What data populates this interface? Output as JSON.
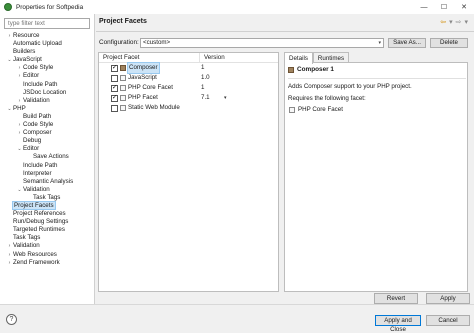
{
  "window": {
    "title": "Properties for Softpedia",
    "minimize": "—",
    "maximize": "☐",
    "close": "✕"
  },
  "sidebar": {
    "filter_placeholder": "type filter text",
    "items": [
      {
        "label": "Resource",
        "arrow": "›",
        "indent": 0
      },
      {
        "label": "Automatic Upload",
        "arrow": "",
        "indent": 0
      },
      {
        "label": "Builders",
        "arrow": "",
        "indent": 0
      },
      {
        "label": "JavaScript",
        "arrow": "⌄",
        "indent": 0
      },
      {
        "label": "Code Style",
        "arrow": "›",
        "indent": 1
      },
      {
        "label": "Editor",
        "arrow": "›",
        "indent": 1
      },
      {
        "label": "Include Path",
        "arrow": "",
        "indent": 1
      },
      {
        "label": "JSDoc Location",
        "arrow": "",
        "indent": 1
      },
      {
        "label": "Validation",
        "arrow": "›",
        "indent": 1
      },
      {
        "label": "PHP",
        "arrow": "⌄",
        "indent": 0
      },
      {
        "label": "Build Path",
        "arrow": "",
        "indent": 1
      },
      {
        "label": "Code Style",
        "arrow": "›",
        "indent": 1
      },
      {
        "label": "Composer",
        "arrow": "›",
        "indent": 1
      },
      {
        "label": "Debug",
        "arrow": "",
        "indent": 1
      },
      {
        "label": "Editor",
        "arrow": "⌄",
        "indent": 1
      },
      {
        "label": "Save Actions",
        "arrow": "",
        "indent": 2
      },
      {
        "label": "Include Path",
        "arrow": "",
        "indent": 1
      },
      {
        "label": "Interpreter",
        "arrow": "",
        "indent": 1
      },
      {
        "label": "Semantic Analysis",
        "arrow": "",
        "indent": 1
      },
      {
        "label": "Validation",
        "arrow": "⌄",
        "indent": 1
      },
      {
        "label": "Task Tags",
        "arrow": "",
        "indent": 2
      },
      {
        "label": "Project Facets",
        "arrow": "",
        "indent": 0,
        "selected": true
      },
      {
        "label": "Project References",
        "arrow": "",
        "indent": 0
      },
      {
        "label": "Run/Debug Settings",
        "arrow": "",
        "indent": 0
      },
      {
        "label": "Targeted Runtimes",
        "arrow": "",
        "indent": 0
      },
      {
        "label": "Task Tags",
        "arrow": "",
        "indent": 0
      },
      {
        "label": "Validation",
        "arrow": "›",
        "indent": 0
      },
      {
        "label": "Web Resources",
        "arrow": "›",
        "indent": 0
      },
      {
        "label": "Zend Framework",
        "arrow": "›",
        "indent": 0
      }
    ]
  },
  "main": {
    "page_title": "Project Facets",
    "nav_back": "⇦",
    "nav_back_menu": "▾",
    "nav_forward": "⇨",
    "nav_forward_menu": "▾",
    "config_label": "Configuration:",
    "config_value": "<custom>",
    "dropdown_arrow": "▾",
    "save_as_label": "Save As...",
    "delete_label": "Delete",
    "facets_header": {
      "facet": "Project Facet",
      "version": "Version"
    },
    "facets": [
      {
        "name": "Composer",
        "version": "1",
        "checked": true,
        "selected": true,
        "icon": "composer-icon",
        "dropdown": ""
      },
      {
        "name": "JavaScript",
        "version": "1.0",
        "checked": false,
        "selected": false,
        "icon": "facet-icon",
        "dropdown": ""
      },
      {
        "name": "PHP Core Facet",
        "version": "1",
        "checked": true,
        "selected": false,
        "icon": "facet-icon",
        "dropdown": ""
      },
      {
        "name": "PHP Facet",
        "version": "7.1",
        "checked": true,
        "selected": false,
        "icon": "facet-icon",
        "dropdown": "▾"
      },
      {
        "name": "Static Web Module",
        "version": "",
        "checked": false,
        "selected": false,
        "icon": "facet-icon",
        "dropdown": ""
      }
    ],
    "tabs": [
      {
        "label": "Details",
        "active": true
      },
      {
        "label": "Runtimes",
        "active": false
      }
    ],
    "details": {
      "title": "Composer 1",
      "description": "Adds Composer support to your PHP project.",
      "requires_label": "Requires the following facet:",
      "required_facet": "PHP Core Facet"
    },
    "revert_label": "Revert",
    "apply_label": "Apply"
  },
  "footer": {
    "help_label": "?",
    "apply_close_label": "Apply and Close",
    "cancel_label": "Cancel"
  }
}
